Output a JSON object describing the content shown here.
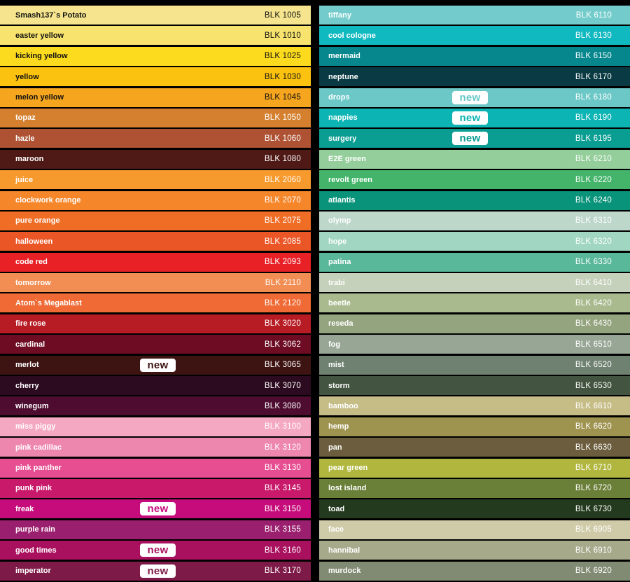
{
  "new_label": "new",
  "left_column": [
    {
      "name": "Smash137`s Potato",
      "code": "BLK 1005",
      "color": "#F6E58E",
      "text": "#111111",
      "is_new": false
    },
    {
      "name": "easter yellow",
      "code": "BLK 1010",
      "color": "#F7E36E",
      "text": "#111111",
      "is_new": false
    },
    {
      "name": "kicking yellow",
      "code": "BLK 1025",
      "color": "#FCDA1D",
      "text": "#111111",
      "is_new": false
    },
    {
      "name": "yellow",
      "code": "BLK 1030",
      "color": "#FCC210",
      "text": "#111111",
      "is_new": false
    },
    {
      "name": "melon yellow",
      "code": "BLK 1045",
      "color": "#F6A61E",
      "text": "#111111",
      "is_new": false
    },
    {
      "name": "topaz",
      "code": "BLK 1050",
      "color": "#D5802E",
      "text": "#FFFFFF",
      "is_new": false
    },
    {
      "name": "hazle",
      "code": "BLK 1060",
      "color": "#AE5233",
      "text": "#FFFFFF",
      "is_new": false
    },
    {
      "name": "maroon",
      "code": "BLK 1080",
      "color": "#4F1A16",
      "text": "#FFFFFF",
      "is_new": false
    },
    {
      "name": "juice",
      "code": "BLK 2060",
      "color": "#F79A2D",
      "text": "#FFFFFF",
      "is_new": false
    },
    {
      "name": "clockwork orange",
      "code": "BLK 2070",
      "color": "#F5862A",
      "text": "#FFFFFF",
      "is_new": false
    },
    {
      "name": "pure orange",
      "code": "BLK 2075",
      "color": "#F06D26",
      "text": "#FFFFFF",
      "is_new": false
    },
    {
      "name": "halloween",
      "code": "BLK 2085",
      "color": "#EB5626",
      "text": "#FFFFFF",
      "is_new": false
    },
    {
      "name": "code red",
      "code": "BLK 2093",
      "color": "#E82127",
      "text": "#FFFFFF",
      "is_new": false
    },
    {
      "name": "tomorrow",
      "code": "BLK 2110",
      "color": "#F28E53",
      "text": "#FFFFFF",
      "is_new": false
    },
    {
      "name": "Atom`s Megablast",
      "code": "BLK 2120",
      "color": "#EF6A35",
      "text": "#FFFFFF",
      "is_new": false
    },
    {
      "name": "fire rose",
      "code": "BLK 3020",
      "color": "#B71C25",
      "text": "#FFFFFF",
      "is_new": false
    },
    {
      "name": "cardinal",
      "code": "BLK 3062",
      "color": "#6D0C23",
      "text": "#FFFFFF",
      "is_new": false
    },
    {
      "name": "merlot",
      "code": "BLK 3065",
      "color": "#3E1413",
      "text": "#FFFFFF",
      "is_new": true
    },
    {
      "name": "cherry",
      "code": "BLK 3070",
      "color": "#2C0A1F",
      "text": "#FFFFFF",
      "is_new": false
    },
    {
      "name": "winegum",
      "code": "BLK 3080",
      "color": "#4D0C30",
      "text": "#FFFFFF",
      "is_new": false
    },
    {
      "name": "miss piggy",
      "code": "BLK 3100",
      "color": "#F5A8C1",
      "text": "#FFFFFF",
      "is_new": false
    },
    {
      "name": "pink cadillac",
      "code": "BLK 3120",
      "color": "#EE87AE",
      "text": "#FFFFFF",
      "is_new": false
    },
    {
      "name": "pink panther",
      "code": "BLK 3130",
      "color": "#E74D91",
      "text": "#FFFFFF",
      "is_new": false
    },
    {
      "name": "punk pink",
      "code": "BLK 3145",
      "color": "#C8196B",
      "text": "#FFFFFF",
      "is_new": false
    },
    {
      "name": "freak",
      "code": "BLK 3150",
      "color": "#C60C7B",
      "text": "#FFFFFF",
      "is_new": true
    },
    {
      "name": "purple rain",
      "code": "BLK 3155",
      "color": "#9A1F6E",
      "text": "#FFFFFF",
      "is_new": false
    },
    {
      "name": "good times",
      "code": "BLK 3160",
      "color": "#A9115F",
      "text": "#FFFFFF",
      "is_new": true
    },
    {
      "name": "imperator",
      "code": "BLK 3170",
      "color": "#7E1A47",
      "text": "#FFFFFF",
      "is_new": true
    }
  ],
  "right_column": [
    {
      "name": "tiffany",
      "code": "BLK 6110",
      "color": "#73CCCB",
      "text": "#FFFFFF",
      "is_new": false
    },
    {
      "name": "cool cologne",
      "code": "BLK 6130",
      "color": "#10B9C0",
      "text": "#FFFFFF",
      "is_new": false
    },
    {
      "name": "mermaid",
      "code": "BLK 6150",
      "color": "#06878D",
      "text": "#FFFFFF",
      "is_new": false
    },
    {
      "name": "neptune",
      "code": "BLK 6170",
      "color": "#0A3A43",
      "text": "#FFFFFF",
      "is_new": false
    },
    {
      "name": "drops",
      "code": "BLK 6180",
      "color": "#6CC8C7",
      "text": "#FFFFFF",
      "is_new": true
    },
    {
      "name": "nappies",
      "code": "BLK 6190",
      "color": "#0CB5B3",
      "text": "#FFFFFF",
      "is_new": true
    },
    {
      "name": "surgery",
      "code": "BLK 6195",
      "color": "#0A9D92",
      "text": "#FFFFFF",
      "is_new": true
    },
    {
      "name": "E2E green",
      "code": "BLK 6210",
      "color": "#94CE9B",
      "text": "#FFFFFF",
      "is_new": false
    },
    {
      "name": "revolt green",
      "code": "BLK 6220",
      "color": "#44B46A",
      "text": "#FFFFFF",
      "is_new": false
    },
    {
      "name": "atlantis",
      "code": "BLK 6240",
      "color": "#09937A",
      "text": "#FFFFFF",
      "is_new": false
    },
    {
      "name": "olymp",
      "code": "BLK 6310",
      "color": "#BDD7CB",
      "text": "#FFFFFF",
      "is_new": false
    },
    {
      "name": "hope",
      "code": "BLK 6320",
      "color": "#A1D6C3",
      "text": "#FFFFFF",
      "is_new": false
    },
    {
      "name": "patina",
      "code": "BLK 6330",
      "color": "#59B79A",
      "text": "#FFFFFF",
      "is_new": false
    },
    {
      "name": "trabi",
      "code": "BLK 6410",
      "color": "#C6D1BB",
      "text": "#FFFFFF",
      "is_new": false
    },
    {
      "name": "beetle",
      "code": "BLK 6420",
      "color": "#A9BB8E",
      "text": "#FFFFFF",
      "is_new": false
    },
    {
      "name": "reseda",
      "code": "BLK 6430",
      "color": "#94A47F",
      "text": "#FFFFFF",
      "is_new": false
    },
    {
      "name": "fog",
      "code": "BLK 6510",
      "color": "#98A695",
      "text": "#FFFFFF",
      "is_new": false
    },
    {
      "name": "mist",
      "code": "BLK 6520",
      "color": "#6F8170",
      "text": "#FFFFFF",
      "is_new": false
    },
    {
      "name": "storm",
      "code": "BLK 6530",
      "color": "#435440",
      "text": "#FFFFFF",
      "is_new": false
    },
    {
      "name": "bamboo",
      "code": "BLK 6610",
      "color": "#C6BD86",
      "text": "#FFFFFF",
      "is_new": false
    },
    {
      "name": "hemp",
      "code": "BLK 6620",
      "color": "#9F9350",
      "text": "#FFFFFF",
      "is_new": false
    },
    {
      "name": "pan",
      "code": "BLK 6630",
      "color": "#6B5D3E",
      "text": "#FFFFFF",
      "is_new": false
    },
    {
      "name": "pear green",
      "code": "BLK 6710",
      "color": "#B1B73E",
      "text": "#FFFFFF",
      "is_new": false
    },
    {
      "name": "lost island",
      "code": "BLK 6720",
      "color": "#6A7F38",
      "text": "#FFFFFF",
      "is_new": false
    },
    {
      "name": "toad",
      "code": "BLK 6730",
      "color": "#243A1E",
      "text": "#FFFFFF",
      "is_new": false
    },
    {
      "name": "face",
      "code": "BLK 6905",
      "color": "#CFCBA8",
      "text": "#FFFFFF",
      "is_new": false
    },
    {
      "name": "hannibal",
      "code": "BLK 6910",
      "color": "#A6AA8A",
      "text": "#FFFFFF",
      "is_new": false
    },
    {
      "name": "murdock",
      "code": "BLK 6920",
      "color": "#818A72",
      "text": "#FFFFFF",
      "is_new": false
    }
  ]
}
